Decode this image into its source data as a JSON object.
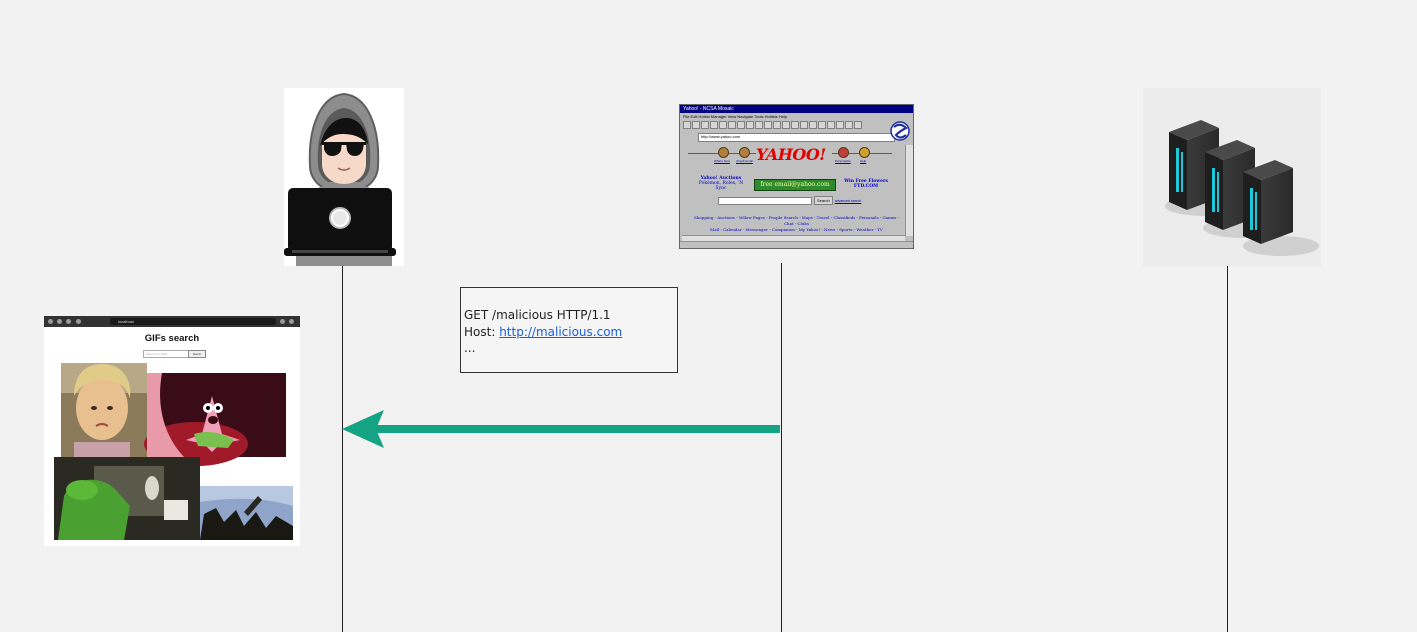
{
  "actors": {
    "attacker": {
      "icon": "hacker-laptop-icon"
    },
    "browser": {
      "icon": "retro-browser-screenshot",
      "window_title": "Yahoo! - NCSA Mosaic",
      "menu": "File  Edit  Hotlist Manager  View  Navigate  Tools  Hotlists  Help",
      "url": "http://www.yahoo.com",
      "logo_text": "YAHOO!",
      "nav_labels": [
        "What's New",
        "Check Email",
        "Personalize",
        "Help"
      ],
      "auctions_text": "Yahoo! Auctions",
      "auctions_sub": "Pokémon, Rolex, 'N Sync",
      "promo_text": "free email@yahoo.com",
      "flowers_text": "Win Free Flowers",
      "flowers_sub": "FTD.COM",
      "search_button": "Search",
      "advanced_search": "advanced search",
      "links_line1": "Shopping - Auctions - Yellow Pages - People Search - Maps - Travel - Classifieds - Personals - Games - Chat - Clubs",
      "links_line2": "Mail - Calendar - Messenger - Companion - My Yahoo! - News - Sports - Weather - TV"
    },
    "server": {
      "icon": "server-racks-icon"
    }
  },
  "message": {
    "lines": [
      "GET /malicious HTTP/1.1",
      "Host: ",
      "..."
    ],
    "host_link": "http://malicious.com"
  },
  "arrow": {
    "color": "#14a383",
    "direction": "left",
    "from": "browser",
    "to": "attacker"
  },
  "gif_screenshot": {
    "url": "localhost",
    "title": "GIFs search",
    "search_placeholder": "Search for GIFs",
    "search_button": "Get it!"
  }
}
